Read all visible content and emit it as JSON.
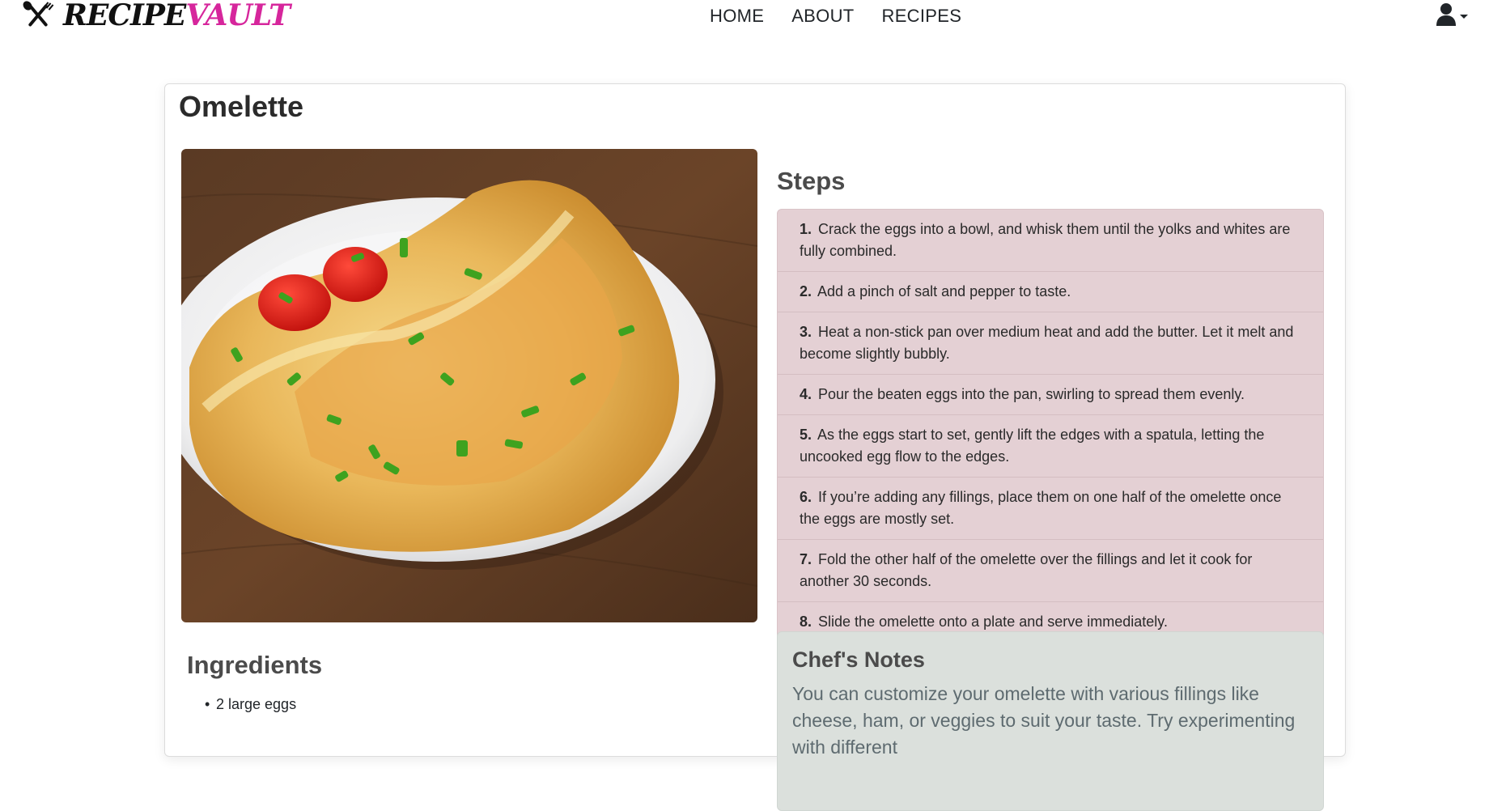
{
  "brand": {
    "part1": "RECIPE",
    "part2": "VAULT",
    "icon": "fork-knife-icon"
  },
  "nav": {
    "links": [
      "HOME",
      "ABOUT",
      "RECIPES"
    ]
  },
  "user_menu": {
    "icon": "user-icon",
    "caret": "caret-down-icon"
  },
  "recipe": {
    "title": "Omelette",
    "image_alt": "Omelette on a white plate",
    "ingredients_title": "Ingredients",
    "ingredients": [
      "2 large eggs"
    ],
    "steps_title": "Steps",
    "steps": [
      {
        "num": "1.",
        "text": "Crack the eggs into a bowl, and whisk them until the yolks and whites are fully combined."
      },
      {
        "num": "2.",
        "text": "Add a pinch of salt and pepper to taste."
      },
      {
        "num": "3.",
        "text": "Heat a non-stick pan over medium heat and add the butter. Let it melt and become slightly bubbly."
      },
      {
        "num": "4.",
        "text": "Pour the beaten eggs into the pan, swirling to spread them evenly."
      },
      {
        "num": "5.",
        "text": "As the eggs start to set, gently lift the edges with a spatula, letting the uncooked egg flow to the edges."
      },
      {
        "num": "6.",
        "text": "If you’re adding any fillings, place them on one half of the omelette once the eggs are mostly set."
      },
      {
        "num": "7.",
        "text": "Fold the other half of the omelette over the fillings and let it cook for another 30 seconds."
      },
      {
        "num": "8.",
        "text": "Slide the omelette onto a plate and serve immediately."
      }
    ],
    "notes_title": "Chef's Notes",
    "notes_text": "You can customize your omelette with various fillings like cheese, ham, or veggies to suit your taste. Try experimenting with different"
  },
  "colors": {
    "brand_accent": "#d6269c",
    "steps_bg": "#e4d0d4",
    "notes_bg": "#dbe0dc"
  }
}
